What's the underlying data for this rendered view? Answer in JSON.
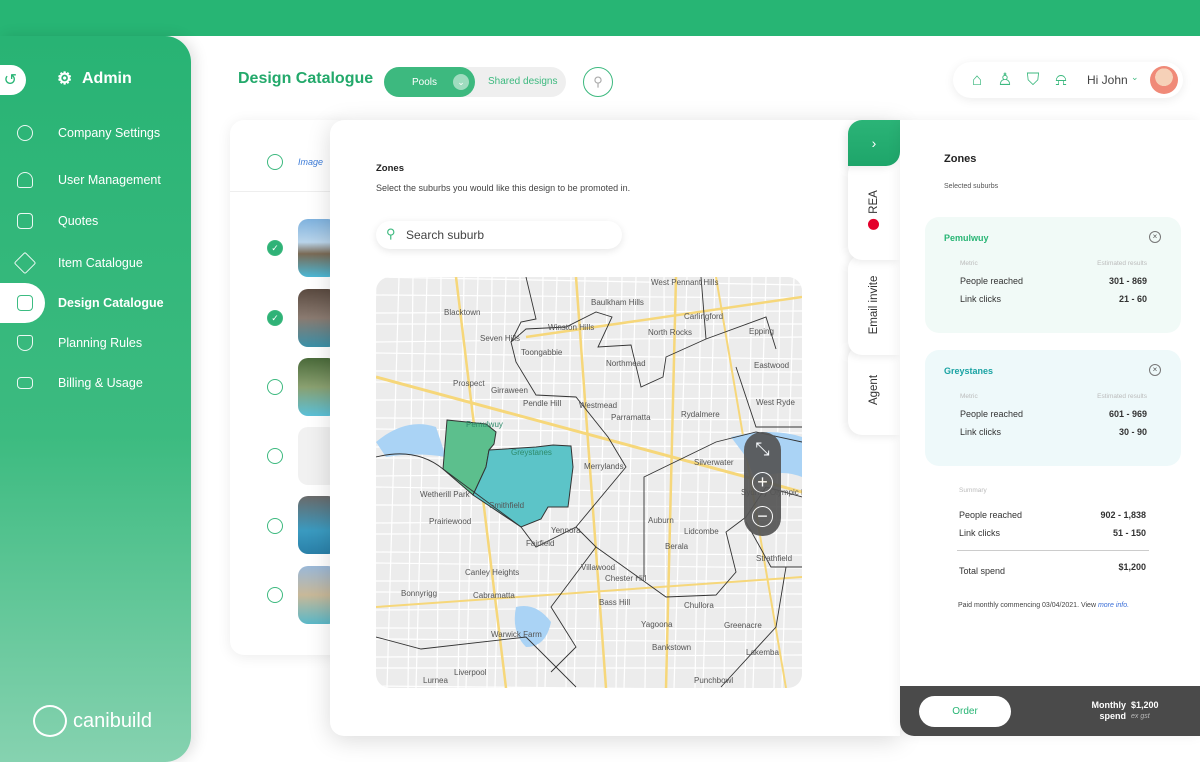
{
  "brand": {
    "name": "canibuild",
    "accent": "#27b574",
    "teal": "#1aa3a3",
    "footer_bg": "#4a4a4a"
  },
  "sidebar": {
    "back_icon": "undo-arrow-icon",
    "title": "Admin",
    "items": [
      {
        "label": "Company Settings",
        "icon": "wrench-icon"
      },
      {
        "label": "User Management",
        "icon": "users-icon"
      },
      {
        "label": "Quotes",
        "icon": "dollar-document-icon"
      },
      {
        "label": "Item Catalogue",
        "icon": "tag-icon"
      },
      {
        "label": "Design Catalogue",
        "icon": "catalogue-box-icon",
        "active": true
      },
      {
        "label": "Planning Rules",
        "icon": "shield-icon"
      },
      {
        "label": "Billing & Usage",
        "icon": "credit-card-icon"
      }
    ]
  },
  "header": {
    "title": "Design Catalogue",
    "toggle": {
      "active": "Pools",
      "inactive": "Shared designs"
    },
    "user_greeting": "Hi John",
    "icons": [
      "home-icon",
      "stamp-icon",
      "bookmark-icon",
      "bell-icon"
    ]
  },
  "list": {
    "image_column": "Image",
    "rows": [
      {
        "checked": true
      },
      {
        "checked": true
      },
      {
        "checked": false
      },
      {
        "checked": false,
        "empty": true
      },
      {
        "checked": false
      },
      {
        "checked": false
      }
    ]
  },
  "modal": {
    "title": "Zones",
    "subtitle": "Select the suburbs you would like this design to be promoted in.",
    "search_placeholder": "Search suburb",
    "map_labels": [
      "West Pennant Hills",
      "Baulkham Hills",
      "Blacktown",
      "Carlingford",
      "Winston Hills",
      "North Rocks",
      "Epping",
      "Seven Hills",
      "Toongabbie",
      "Northmead",
      "Eastwood",
      "Prospect",
      "Girraween",
      "Pendle Hill",
      "Westmead",
      "Parramatta",
      "Rydalmere",
      "West Ryde",
      "Pemulwuy",
      "Greystanes",
      "Merrylands",
      "Silverwater",
      "Wetherill Park",
      "Smithfield",
      "Prairiewood",
      "Yennora",
      "Fairfield",
      "Auburn",
      "Lidcombe",
      "Berala",
      "Sydney Olympic Park",
      "Strathfield",
      "Canley Heights",
      "Villawood",
      "Chester Hill",
      "Bonnyrigg",
      "Cabramatta",
      "Bass Hill",
      "Chullora",
      "Yagoona",
      "Greenacre",
      "Warwick Farm",
      "Bankstown",
      "Lakemba",
      "Liverpool",
      "Lurnea",
      "Punchbowl"
    ],
    "map_colors": {
      "pemulwuy": "#5cbf8d",
      "greystanes": "#5cc4c8"
    }
  },
  "tabs": [
    {
      "label": "REA"
    },
    {
      "label": "Email invite"
    },
    {
      "label": "Agent"
    }
  ],
  "zones_panel": {
    "title": "Zones",
    "subtitle": "Selected suburbs",
    "metric_header": "Metric",
    "results_header": "Estimated results",
    "suburbs": [
      {
        "name": "Pemulwuy",
        "people_label": "People reached",
        "people": "301 - 869",
        "clicks_label": "Link clicks",
        "clicks": "21 - 60"
      },
      {
        "name": "Greystanes",
        "people_label": "People reached",
        "people": "601 - 969",
        "clicks_label": "Link clicks",
        "clicks": "30 - 90"
      }
    ],
    "summary": {
      "label": "Summary",
      "people_label": "People reached",
      "people": "902 - 1,838",
      "clicks_label": "Link clicks",
      "clicks": "51 - 150",
      "total_label": "Total spend",
      "total": "$1,200"
    },
    "paid_note": "Paid monthly commencing 03/04/2021. View ",
    "more_info": "more info."
  },
  "footer": {
    "order_label": "Order",
    "monthly_label": "Monthly spend",
    "price": "$1,200",
    "gst": "ex gst"
  }
}
